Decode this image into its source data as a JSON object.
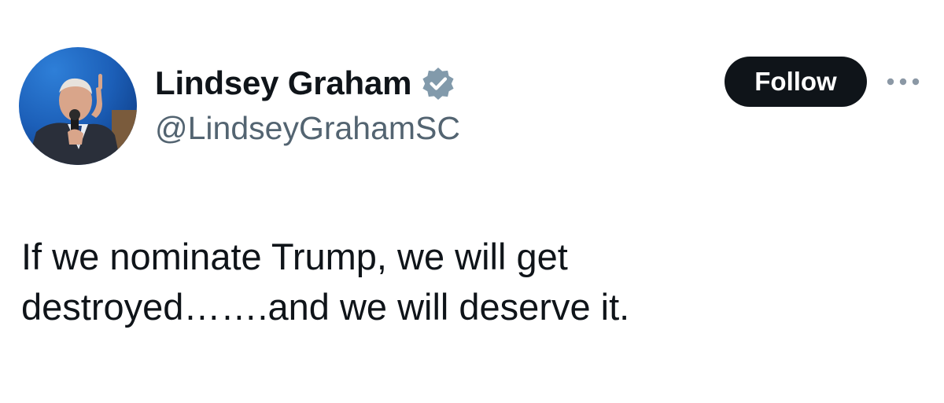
{
  "author": {
    "display_name": "Lindsey Graham",
    "handle": "@LindseyGrahamSC",
    "verified": true
  },
  "actions": {
    "follow_label": "Follow"
  },
  "icons": {
    "verified": "verified-badge-icon",
    "more": "more-options-icon"
  },
  "tweet": {
    "lines": [
      "If we nominate Trump, we will get",
      "destroyed…….and we will deserve it."
    ]
  },
  "colors": {
    "text_primary": "#0f1419",
    "text_secondary": "#536471",
    "follow_bg": "#0f1419",
    "follow_text": "#ffffff",
    "verified_badge": "#829aab",
    "more_dots": "#8b98a5"
  }
}
